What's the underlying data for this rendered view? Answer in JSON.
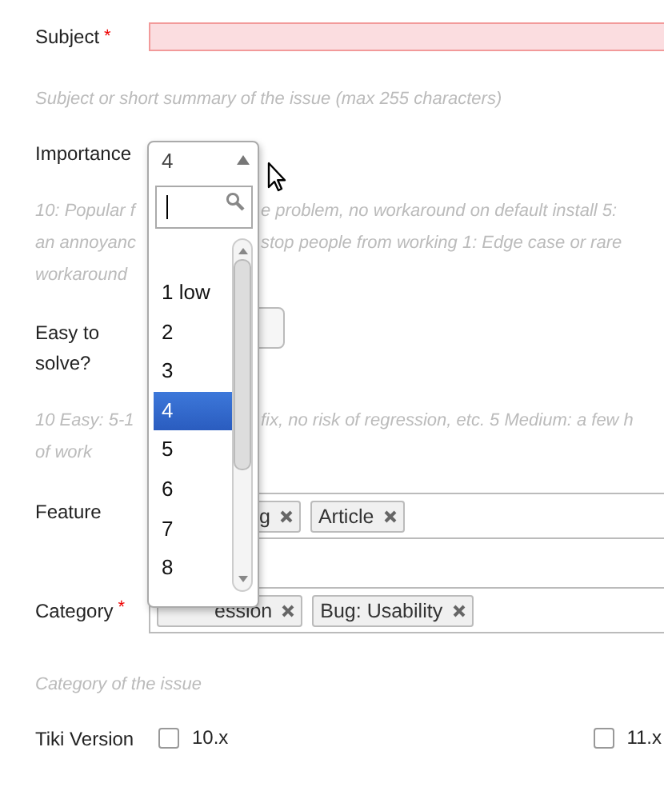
{
  "subject": {
    "label": "Subject",
    "required_mark": "*",
    "invalid": true,
    "help": "Subject or short summary of the issue (max 255 characters)"
  },
  "importance": {
    "label": "Importance",
    "value": "4",
    "help_lines": [
      {
        "left": "10: Popular f",
        "right": "e problem, no workaround on default install 5:"
      },
      {
        "left": "an annoyanc",
        "right": "stop people from working 1: Edge case or rare"
      },
      {
        "left": "workaround"
      }
    ],
    "options": [
      {
        "label": "1 low",
        "selected": false
      },
      {
        "label": "2",
        "selected": false
      },
      {
        "label": "3",
        "selected": false
      },
      {
        "label": "4",
        "selected": true
      },
      {
        "label": "5",
        "selected": false
      },
      {
        "label": "6",
        "selected": false
      },
      {
        "label": "7",
        "selected": false
      },
      {
        "label": "8",
        "selected": false
      }
    ]
  },
  "easy": {
    "label": "Easy to solve?",
    "help_lines": [
      {
        "left": "10 Easy: 5-1",
        "right": "fix, no risk of regression, etc. 5 Medium: a few h"
      },
      {
        "left": "of work"
      }
    ]
  },
  "feature": {
    "label": "Feature",
    "tags": [
      {
        "label": "g"
      },
      {
        "label": "Article"
      }
    ]
  },
  "category": {
    "label": "Category",
    "required_mark": "*",
    "tags": [
      {
        "label": "ession"
      },
      {
        "label": "Bug: Usability"
      }
    ],
    "help": "Category of the issue"
  },
  "tiki_version": {
    "label": "Tiki Version",
    "options": [
      {
        "label": "10.x",
        "checked": false
      },
      {
        "label": "11.x",
        "checked": false
      }
    ]
  }
}
